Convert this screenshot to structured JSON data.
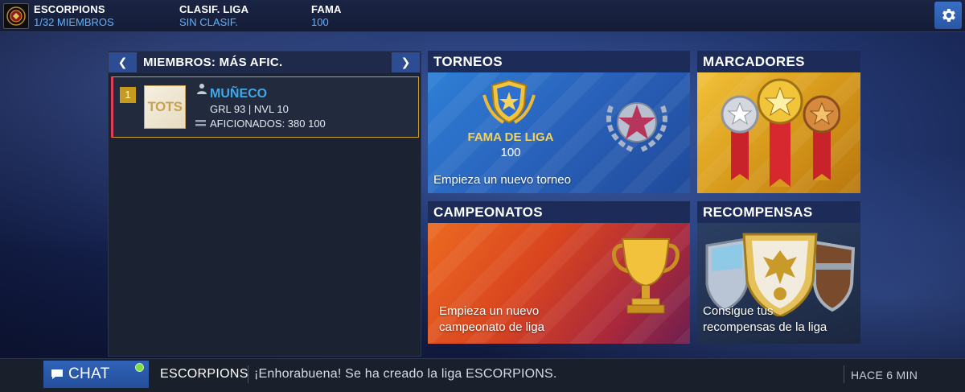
{
  "topbar": {
    "club_name": "ESCORPIONS",
    "members_count": "1/32 MIEMBROS",
    "league_label": "CLASIF. LIGA",
    "league_value": "SIN CLASIF.",
    "fame_label": "FAMA",
    "fame_value": "100",
    "settings_icon": "gear-icon"
  },
  "members": {
    "title": "MIEMBROS: MÁS AFIC.",
    "prev_icon": "chevron-left-icon",
    "next_icon": "chevron-right-icon",
    "list": [
      {
        "rank": "1",
        "card_text": "TOTS",
        "name": "MUÑECO",
        "stats": "GRL 93 | NVL 10",
        "fans": "AFICIONADOS: 380 100"
      }
    ]
  },
  "tiles": {
    "torneos": {
      "title": "TORNEOS",
      "fame_label": "FAMA DE LIGA",
      "fame_value": "100",
      "caption": "Empieza un nuevo torneo"
    },
    "marcadores": {
      "title": "MARCADORES"
    },
    "campeonatos": {
      "title": "CAMPEONATOS",
      "caption_line1": "Empieza un nuevo",
      "caption_line2": "campeonato de liga"
    },
    "recompensas": {
      "title": "RECOMPENSAS",
      "caption_line1": "Consigue tus",
      "caption_line2": "recompensas de la liga"
    }
  },
  "chat": {
    "button_label": "CHAT",
    "sender": "ESCORPIONS",
    "message": "¡Enhorabuena! Se ha creado la liga ESCORPIONS.",
    "time": "HACE 6 MIN"
  },
  "colors": {
    "accent_blue": "#5fb3ff",
    "gold": "#c59a1e",
    "online": "#7be043"
  }
}
